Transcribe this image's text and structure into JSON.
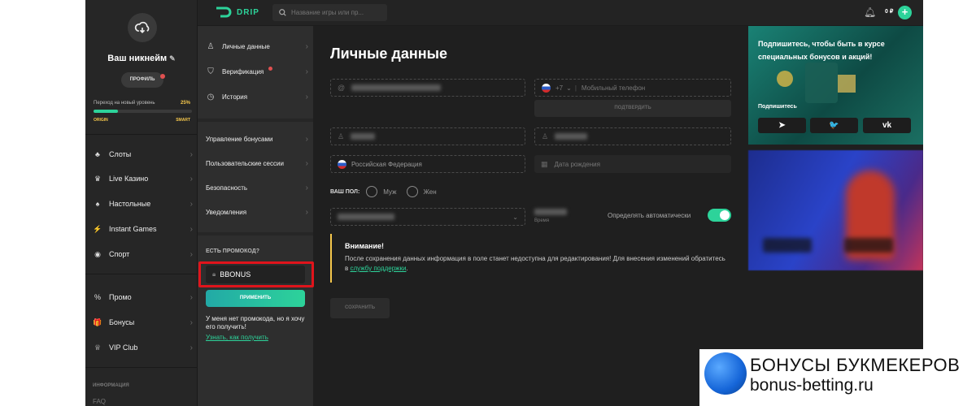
{
  "header": {
    "logo_text": "DRIP",
    "search_placeholder": "Название игры или пр...",
    "balance": "0 ₽"
  },
  "sidebar": {
    "nickname": "Ваш никнейм",
    "profile_button": "ПРОФИЛЬ",
    "level": {
      "label": "Переход на новый уровень",
      "percent_text": "25%",
      "progress": 0.25,
      "from": "ORIGIN",
      "to": "SMART"
    },
    "nav_main": [
      {
        "label": "Слоты",
        "icon": "slots-icon"
      },
      {
        "label": "Live Казино",
        "icon": "live-casino-icon"
      },
      {
        "label": "Настольные",
        "icon": "table-games-icon"
      },
      {
        "label": "Instant Games",
        "icon": "instant-games-icon"
      },
      {
        "label": "Спорт",
        "icon": "sport-icon"
      }
    ],
    "nav_extra": [
      {
        "label": "Промо",
        "icon": "promo-icon"
      },
      {
        "label": "Бонусы",
        "icon": "gift-icon"
      },
      {
        "label": "VIP Club",
        "icon": "trophy-icon"
      }
    ],
    "info_title": "ИНФОРМАЦИЯ",
    "info_more": "FAQ"
  },
  "profile_menu": {
    "group1": [
      {
        "label": "Личные данные",
        "active": true,
        "icon": "user-icon"
      },
      {
        "label": "Верификация",
        "icon": "shield-icon",
        "dot": true
      },
      {
        "label": "История",
        "icon": "clock-icon"
      }
    ],
    "group2": [
      {
        "label": "Управление бонусами"
      },
      {
        "label": "Пользовательские сессии"
      },
      {
        "label": "Безопасность"
      },
      {
        "label": "Уведомления"
      }
    ],
    "promo": {
      "title": "ЕСТЬ ПРОМОКОД?",
      "value": "BBONUS",
      "apply_label": "ПРИМЕНИТЬ",
      "no_code_text": "У меня нет промокода, но я хочу его получить!",
      "link_text": "Узнать, как получить"
    }
  },
  "form": {
    "title": "Личные данные",
    "phone_code": "+7",
    "phone_placeholder": "Мобильный телефон",
    "confirm_label": "ПОДТВЕРДИТЬ",
    "country": "Российская Федерация",
    "birth_placeholder": "Дата рождения",
    "gender_label": "ВАШ ПОЛ:",
    "gender_options": [
      "Муж",
      "Жен"
    ],
    "timezone_label": "Время",
    "auto_detect": "Определять автоматически",
    "auto_detect_on": true,
    "alert_title": "Внимание!",
    "alert_text": "После сохранения данных информация в поле станет недоступна для редактирования! Для внесения изменений обратитесь в",
    "alert_link": "службу поддержки",
    "alert_end": ".",
    "save_label": "СОХРАНИТЬ"
  },
  "right": {
    "promo_text": "Подпишитесь, чтобы быть в курсе специальных бонусов и акций!",
    "subscribe_label": "Подпишитесь",
    "socials": [
      {
        "name": "telegram-icon",
        "glyph": "➤"
      },
      {
        "name": "twitter-icon",
        "glyph": "🐦"
      },
      {
        "name": "vk-icon",
        "glyph": "vk"
      }
    ]
  },
  "watermark": {
    "line1": "БОНУСЫ БУКМЕКЕРОВ",
    "line2": "bonus-betting.ru"
  },
  "colors": {
    "accent": "#2dd39a",
    "highlight": "#e0141b",
    "warning": "#f5c74c"
  }
}
